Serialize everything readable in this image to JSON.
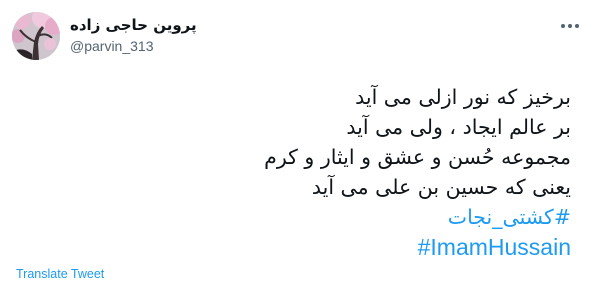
{
  "user": {
    "display_name": "پروین حاجی زاده",
    "handle": "@parvin_313",
    "avatar": "profile-photo-blossoms"
  },
  "header": {
    "more_icon": "more-horizontal-icon"
  },
  "tweet": {
    "lines": [
      "برخیز که نور ازلی می آید",
      "بر عالم ایجاد ، ولی می آید",
      "مجموعه حُسن و عشق و ایثار و کرم",
      "یعنی که حسین بن علی می آید"
    ],
    "hashtags": [
      "#کشتی_نجات",
      "#ImamHussain"
    ]
  },
  "footer": {
    "translate_label": "Translate Tweet"
  },
  "colors": {
    "accent": "#1d9bf0",
    "text": "#0f1419",
    "secondary": "#536471",
    "background": "#ffffff"
  }
}
